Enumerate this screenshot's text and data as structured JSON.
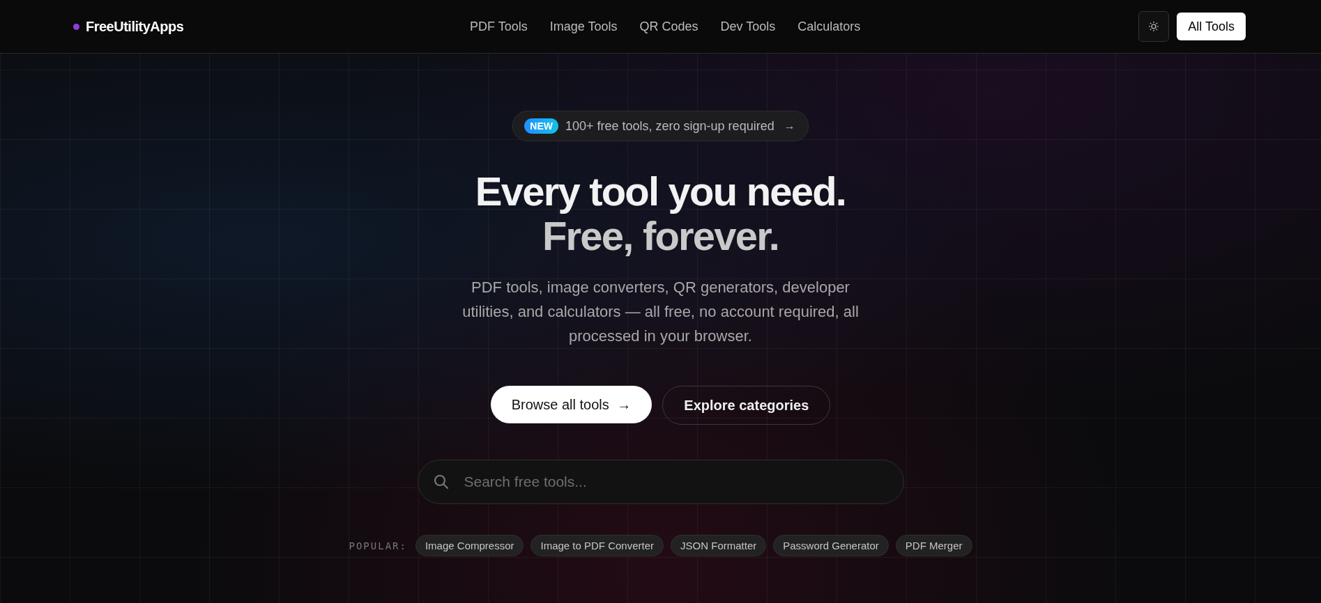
{
  "header": {
    "logo": "FreeUtilityApps",
    "nav": [
      {
        "label": "PDF Tools"
      },
      {
        "label": "Image Tools"
      },
      {
        "label": "QR Codes"
      },
      {
        "label": "Dev Tools"
      },
      {
        "label": "Calculators"
      }
    ],
    "cta": "All Tools"
  },
  "hero": {
    "badge": {
      "tag": "NEW",
      "text": "100+ free tools, zero sign-up required",
      "arrow": "→"
    },
    "title_line_1": "Every tool you need.",
    "title_line_2": "Free, forever.",
    "subtitle": "PDF tools, image converters, QR generators, developer utilities, and calculators — all free, no account required, all processed in your browser.",
    "primary_button": {
      "label": "Browse all tools",
      "arrow": "→"
    },
    "secondary_button": "Explore categories",
    "search": {
      "placeholder": "Search free tools..."
    },
    "popular": {
      "label": "POPULAR:",
      "items": [
        "Image Compressor",
        "Image to PDF Converter",
        "JSON Formatter",
        "Password Generator",
        "PDF Merger"
      ]
    }
  }
}
